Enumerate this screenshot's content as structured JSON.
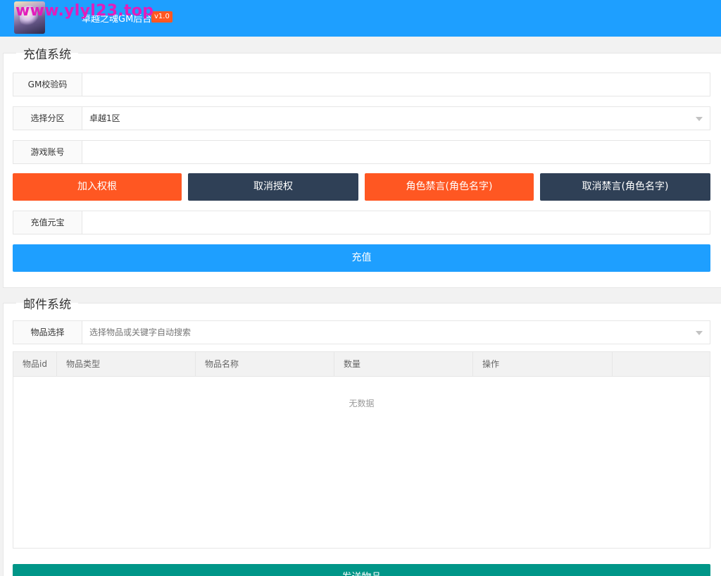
{
  "header": {
    "title": "卓越之魂GM后台",
    "version": "v1.0",
    "watermark": "www.ylyl23.top"
  },
  "recharge": {
    "legend": "充值系统",
    "gm_code": {
      "label": "GM校验码",
      "value": ""
    },
    "server": {
      "label": "选择分区",
      "selected": "卓越1区"
    },
    "account": {
      "label": "游戏账号",
      "value": ""
    },
    "buttons": {
      "add_permission": "加入权根",
      "revoke_permission": "取消授权",
      "ban_role": "角色禁言(角色名字)",
      "unban_role": "取消禁言(角色名字)"
    },
    "yuanbao": {
      "label": "充值元宝",
      "value": ""
    },
    "submit": "充值"
  },
  "mail": {
    "legend": "邮件系统",
    "item_select": {
      "label": "物品选择",
      "placeholder": "选择物品或关键字自动搜索"
    },
    "table": {
      "columns": [
        "物品id",
        "物品类型",
        "物品名称",
        "数量",
        "操作"
      ],
      "empty_text": "无数据"
    },
    "send": "发送物品"
  },
  "colors": {
    "primary": "#1e9fff",
    "warning": "#ff5722",
    "dark": "#2f4056",
    "success": "#009688",
    "watermark": "#e21dbb"
  }
}
